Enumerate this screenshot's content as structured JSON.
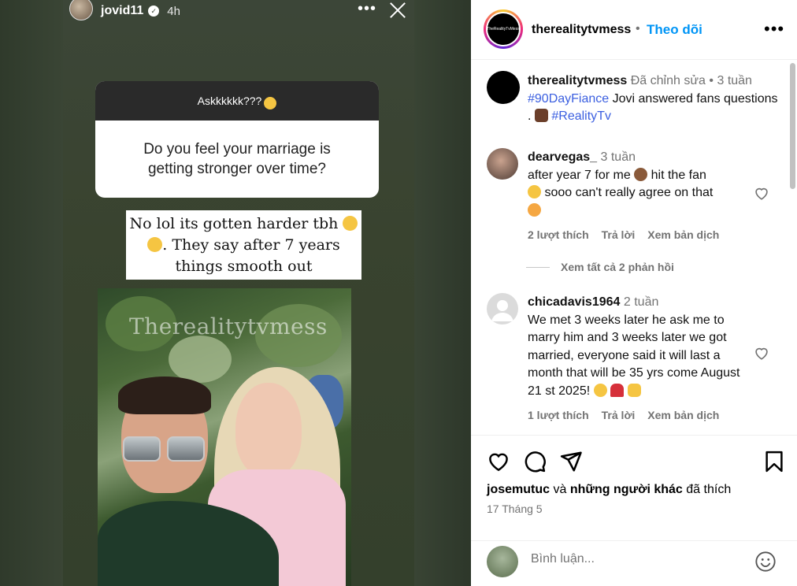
{
  "story": {
    "username": "jovid11",
    "time": "4h",
    "question_header": "Askkkkkk???",
    "question": "Do you feel your marriage is getting stronger over time?",
    "answer_line1": "No lol its gotten harder tbh",
    "answer_line2": ". They say after 7 years",
    "answer_line3": "things smooth out",
    "watermark": "Therealitytvmess"
  },
  "post": {
    "author": "therealitytvmess",
    "follow_label": "Theo dõi",
    "avatar_text": "TheRealityTvMess",
    "caption": {
      "username": "therealitytvmess",
      "edited": "Đã chỉnh sửa",
      "time": "3 tuần",
      "hashtag1": "#90DayFiance",
      "text": "Jovi answered fans questions .",
      "hashtag2": "#RealityTv"
    },
    "comments": [
      {
        "username": "dearvegas_",
        "time": "3 tuần",
        "text_a": "after year 7 for me",
        "text_b": "hit the fan",
        "text_c": "sooo can't really agree on that",
        "likes": "2 lượt thích",
        "reply": "Trả lời",
        "translate": "Xem bản dịch"
      },
      {
        "username": "chicadavis1964",
        "time": "2 tuần",
        "text": "We met 3 weeks later he ask me to marry him and 3 weeks later we got married, everyone said it will last a month that will be 35 yrs come August 21 st 2025!",
        "likes": "1 lượt thích",
        "reply": "Trả lời",
        "translate": "Xem bản dịch"
      }
    ],
    "view_replies": "Xem tất cả 2 phản hồi",
    "liked_by_user": "josemutuc",
    "liked_and": "và",
    "liked_others": "những người khác",
    "liked_suffix": "đã thích",
    "date": "17 Tháng 5",
    "comment_placeholder": "Bình luận..."
  },
  "colors": {
    "link_blue": "#0095f6",
    "hashtag": "#3b5fe0",
    "muted": "#737373"
  }
}
